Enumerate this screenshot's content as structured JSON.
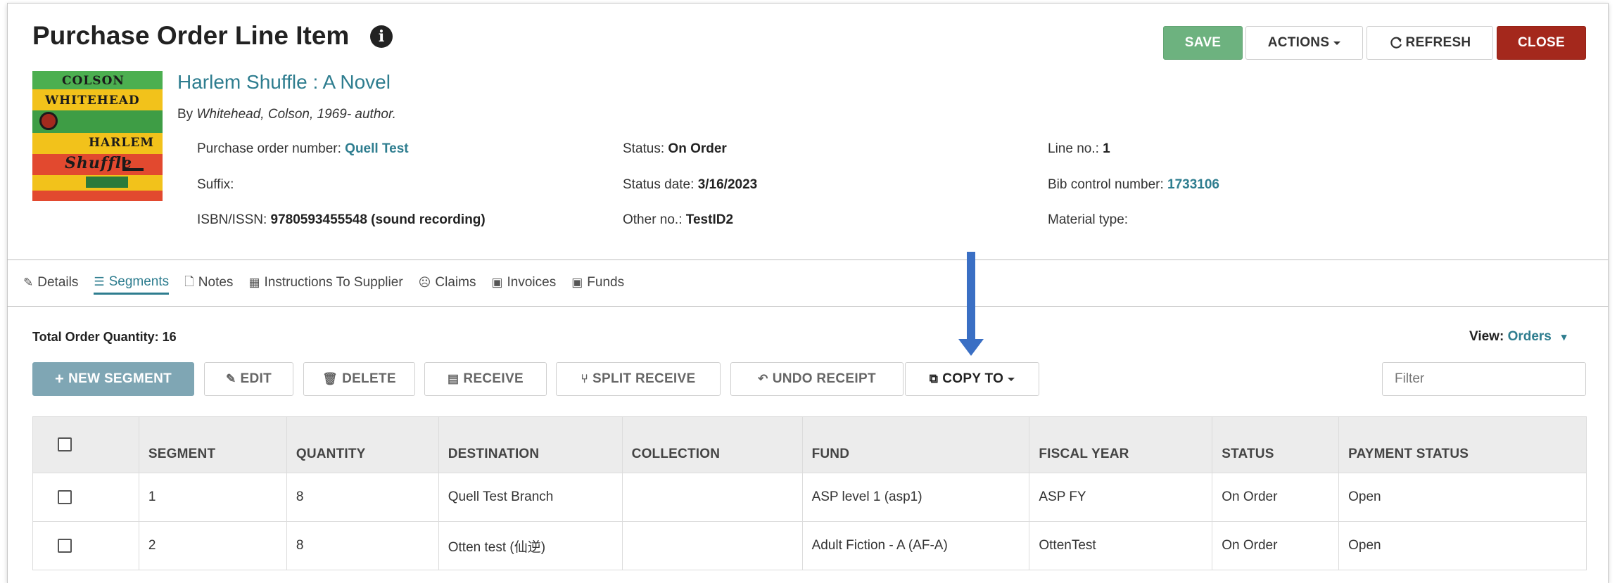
{
  "header": {
    "title": "Purchase Order Line Item",
    "info_icon": "info-circle-icon",
    "buttons": {
      "save": "SAVE",
      "actions": "ACTIONS",
      "refresh": "REFRESH",
      "close": "CLOSE"
    },
    "colors": {
      "save": "#6db27f",
      "close": "#a4281c",
      "link": "#2e7d8f"
    }
  },
  "book": {
    "cover_text": {
      "line1": "COLSON",
      "line2": "WHITEHEAD",
      "line3": "HARLEM",
      "line4": "Shuffle"
    },
    "title": "Harlem Shuffle : A Novel",
    "author_prefix": "By ",
    "author": "Whitehead, Colson, 1969- author."
  },
  "details": {
    "po_number_label": "Purchase order number: ",
    "po_number": "Quell Test",
    "suffix_label": "Suffix:",
    "isbn_label": "ISBN/ISSN: ",
    "isbn": "9780593455548 (sound recording)",
    "status_label": "Status: ",
    "status": "On Order",
    "status_date_label": "Status date: ",
    "status_date": "3/16/2023",
    "other_no_label": "Other no.: ",
    "other_no": "TestID2",
    "line_no_label": "Line no.: ",
    "line_no": "1",
    "bib_label": "Bib control number: ",
    "bib": "1733106",
    "material_label": "Material type:"
  },
  "tabs": [
    {
      "label": "Details",
      "icon": "edit-icon"
    },
    {
      "label": "Segments",
      "icon": "list-icon",
      "active": true
    },
    {
      "label": "Notes",
      "icon": "file-icon"
    },
    {
      "label": "Instructions To Supplier",
      "icon": "building-icon"
    },
    {
      "label": "Claims",
      "icon": "frown-icon"
    },
    {
      "label": "Invoices",
      "icon": "money-icon"
    },
    {
      "label": "Funds",
      "icon": "money-icon"
    }
  ],
  "segments": {
    "total_label": "Total Order Quantity: 16",
    "view_label": "View: ",
    "view_value": "Orders",
    "toolbar": {
      "new": "NEW SEGMENT",
      "edit": "EDIT",
      "delete": "DELETE",
      "receive": "RECEIVE",
      "split": "SPLIT RECEIVE",
      "undo": "UNDO RECEIPT",
      "copy": "COPY TO"
    },
    "filter_placeholder": "Filter",
    "columns": [
      "SEGMENT",
      "QUANTITY",
      "DESTINATION",
      "COLLECTION",
      "FUND",
      "FISCAL YEAR",
      "STATUS",
      "PAYMENT STATUS"
    ],
    "rows": [
      [
        "1",
        "8",
        "Quell Test Branch",
        "",
        "ASP level 1 (asp1)",
        "ASP FY",
        "On Order",
        "Open"
      ],
      [
        "2",
        "8",
        "Otten test (仙逆)",
        "",
        "Adult Fiction - A (AF-A)",
        "OttenTest",
        "On Order",
        "Open"
      ]
    ]
  },
  "annotation": {
    "arrow_color": "#3a6fc4"
  }
}
